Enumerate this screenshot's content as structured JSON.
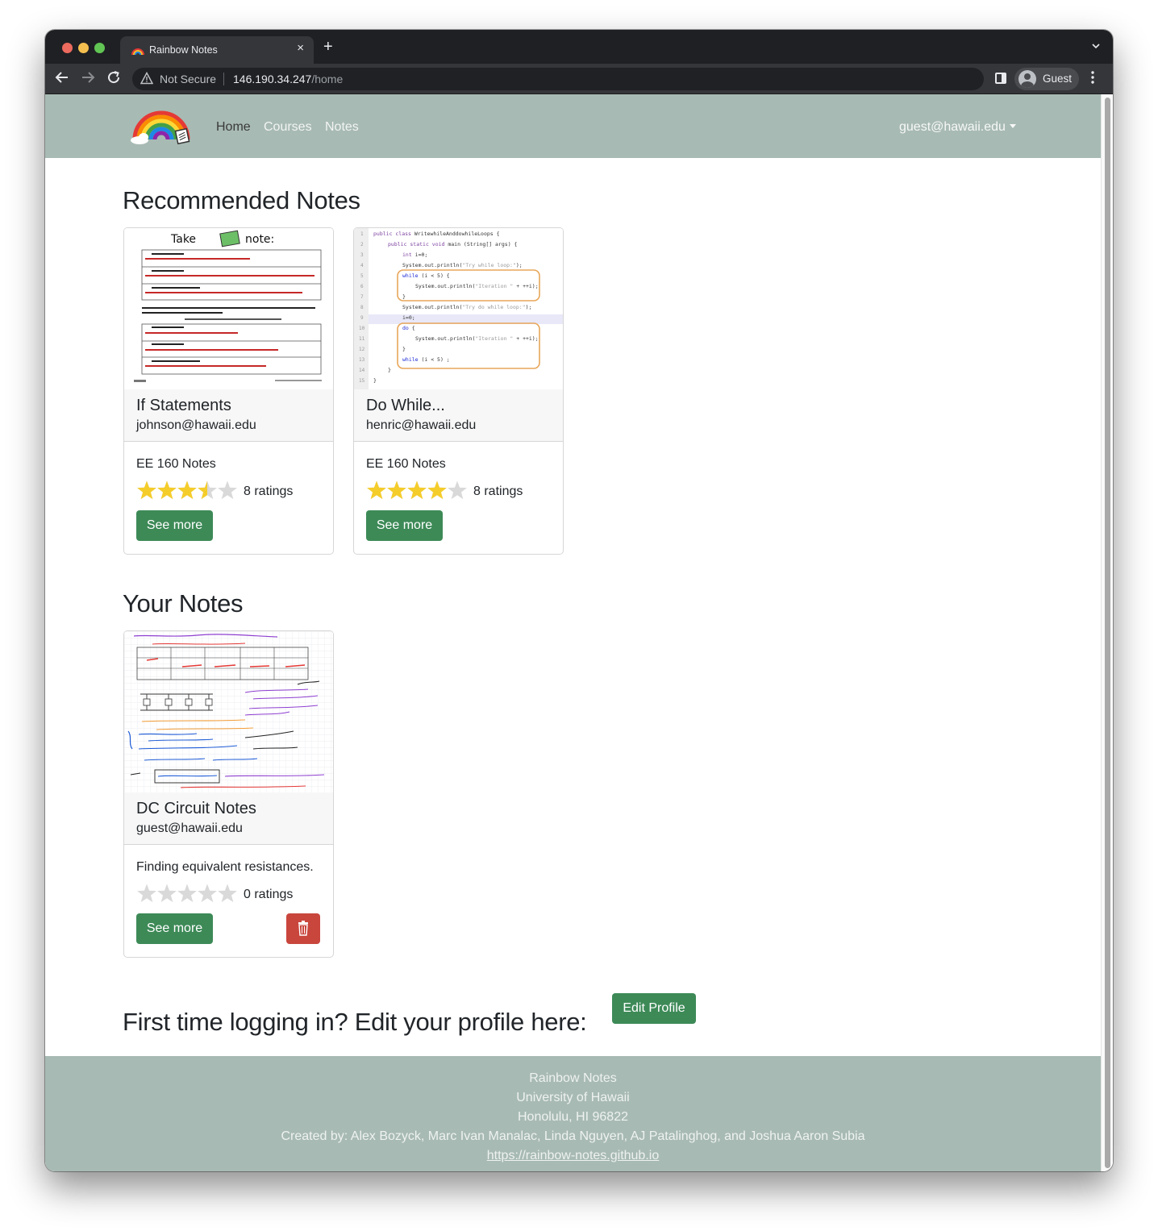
{
  "browser": {
    "tab_title": "Rainbow Notes",
    "tab_close": "×",
    "new_tab": "+",
    "security_label": "Not Secure",
    "url_host": "146.190.34.247",
    "url_path": "/home",
    "profile_name": "Guest",
    "icons": [
      "back-icon",
      "forward-icon",
      "reload-icon",
      "warning-icon",
      "side-panel-icon",
      "profile-icon",
      "menu-icon"
    ]
  },
  "navbar": {
    "links": {
      "home": "Home",
      "courses": "Courses",
      "notes": "Notes"
    },
    "user": "guest@hawaii.edu",
    "background": "#a8bab4"
  },
  "recommended": {
    "heading": "Recommended Notes",
    "cards": [
      {
        "title": "If Statements",
        "owner": "johnson@hawaii.edu",
        "description": "EE 160 Notes",
        "rating": 3.5,
        "ratings_text": "8 ratings",
        "button": "See more"
      },
      {
        "title": "Do While...",
        "owner": "henric@hawaii.edu",
        "description": "EE 160 Notes",
        "rating": 4,
        "ratings_text": "8 ratings",
        "button": "See more"
      }
    ]
  },
  "your_notes": {
    "heading": "Your Notes",
    "cards": [
      {
        "title": "DC Circuit Notes",
        "owner": "guest@hawaii.edu",
        "description": "Finding equivalent resistances.",
        "rating": 0,
        "ratings_text": "0 ratings",
        "button": "See more"
      }
    ]
  },
  "profile_prompt": {
    "text": "First time logging in? Edit your profile here:",
    "button": "Edit Profile"
  },
  "footer": {
    "lines": [
      "Rainbow Notes",
      "University of Hawaii",
      "Honolulu, HI 96822",
      "Created by: Alex Bozyck, Marc Ivan Manalac, Linda Nguyen, AJ Patalinghog, and Joshua Aaron Subia"
    ],
    "link": "https://rainbow-notes.github.io"
  },
  "colors": {
    "accent_green": "#3d8a57",
    "danger_red": "#c9463d",
    "star_gold": "#f5cd2b",
    "star_empty": "#d9d9d9"
  }
}
